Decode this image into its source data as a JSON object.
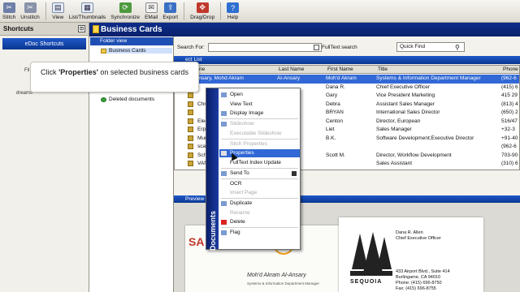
{
  "toolbar": {
    "items": [
      {
        "label": "Stitch",
        "icon": "stitch-icon"
      },
      {
        "label": "Unstitch",
        "icon": "unstitch-icon"
      },
      {
        "label": "View",
        "icon": "view-icon"
      },
      {
        "label": "List/Thumbnails",
        "icon": "thumbnails-icon"
      },
      {
        "label": "Synchronize",
        "icon": "synchronize-icon"
      },
      {
        "label": "EMail",
        "icon": "email-icon"
      },
      {
        "label": "Export",
        "icon": "export-icon"
      },
      {
        "label": "Drag/Drop",
        "icon": "drag-drop-icon"
      },
      {
        "label": "Help",
        "icon": "help-icon"
      }
    ]
  },
  "shortcuts": {
    "title": "Shortcuts",
    "active": "eDoc Shortcuts",
    "items": [
      "Fil",
      "dreams"
    ]
  },
  "main": {
    "title": "Business Cards",
    "folder_view_label": "Folder view",
    "folder_items": [
      "Business Cards",
      "Deleted documents"
    ],
    "search_label": "Search For:",
    "fulltext_label": "FullText search",
    "quick_find_label": "Quick Find",
    "list_title": "ect List",
    "preview_label": "Preview"
  },
  "grid": {
    "columns": [
      "ne",
      "Last Name",
      "First Name",
      "Title",
      "Phone"
    ],
    "rows": [
      {
        "name": "lnsary, Mohd Akram",
        "last": "Al-Ansary",
        "first": "Moh'd Akram",
        "title": "Systems & Information Department Manager",
        "phone": "(962-6",
        "selected": true
      },
      {
        "name": "",
        "last": "",
        "first": "Dana R.",
        "title": "Chief Executive Officer",
        "phone": "(415) 6",
        "selected": false
      },
      {
        "name": "",
        "last": "",
        "first": "Gary",
        "title": "Vice President Marketing",
        "phone": "415 29",
        "selected": false
      },
      {
        "name": "Chris",
        "last": "",
        "first": "Debra",
        "title": "Assistant Sales Manager",
        "phone": "(813) 4",
        "selected": false
      },
      {
        "name": "",
        "last": "",
        "first": "BRYAN",
        "title": "International Sales Director",
        "phone": "(650) 2",
        "selected": false
      },
      {
        "name": "Elect",
        "last": "",
        "first": "Centon",
        "title": "Director, European",
        "phone": "516/47",
        "selected": false
      },
      {
        "name": "Erpel",
        "last": "",
        "first": "Liet",
        "title": "Sales Manager",
        "phone": "+32-3",
        "selected": false
      },
      {
        "name": "Murti",
        "last": "",
        "first": "B.K.",
        "title": "Software Development;Executive Director",
        "phone": "+91-40",
        "selected": false
      },
      {
        "name": "scan",
        "last": "",
        "first": "",
        "title": "",
        "phone": "(962-6",
        "selected": false
      },
      {
        "name": "Schn",
        "last": "",
        "first": "Scott M.",
        "title": "Director, Workflow Development",
        "phone": "703-90",
        "selected": false
      },
      {
        "name": "VAN_",
        "last": "",
        "first": "",
        "title": "Sales Assistant",
        "phone": "(310) 6",
        "selected": false
      }
    ]
  },
  "callout": {
    "prefix": "Click",
    "highlight": "'Properties'",
    "suffix": "on selected business cards"
  },
  "context_menu": {
    "strip_label": "Documents",
    "items": [
      {
        "label": "Open",
        "disabled": false
      },
      {
        "label": "View Text",
        "disabled": false
      },
      {
        "label": "Display Image",
        "disabled": false
      },
      {
        "label": "Slideshow",
        "disabled": true
      },
      {
        "label": "Executable Slideshow",
        "disabled": true
      },
      {
        "label": "Stich Properties",
        "disabled": true
      },
      {
        "label": "Properties",
        "disabled": false,
        "highlighted": true
      },
      {
        "label": "FullText Index Update",
        "disabled": false
      },
      {
        "label": "Send To",
        "disabled": false
      },
      {
        "label": "OCR",
        "disabled": false
      },
      {
        "label": "Insert Page",
        "disabled": true
      },
      {
        "label": "Duplicate",
        "disabled": false
      },
      {
        "label": "Rename",
        "disabled": true
      },
      {
        "label": "Delete",
        "disabled": false
      },
      {
        "label": "Flag",
        "disabled": false
      }
    ]
  },
  "cards": {
    "left": {
      "brand": "SA",
      "name": "Moh'd Akram Al-Ansary",
      "dept": "Systems & Information Department Manager"
    },
    "right": {
      "name": "Dana R. Allen",
      "role": "Chief Executive Officer",
      "company": "SEQUOIA",
      "address": "433 Airport Blvd., Suite 414",
      "city": "Burlingame, CA 94010",
      "phone": "Phone: (415) 696-8750",
      "fax": "Fax: (415) 696-8755"
    }
  }
}
